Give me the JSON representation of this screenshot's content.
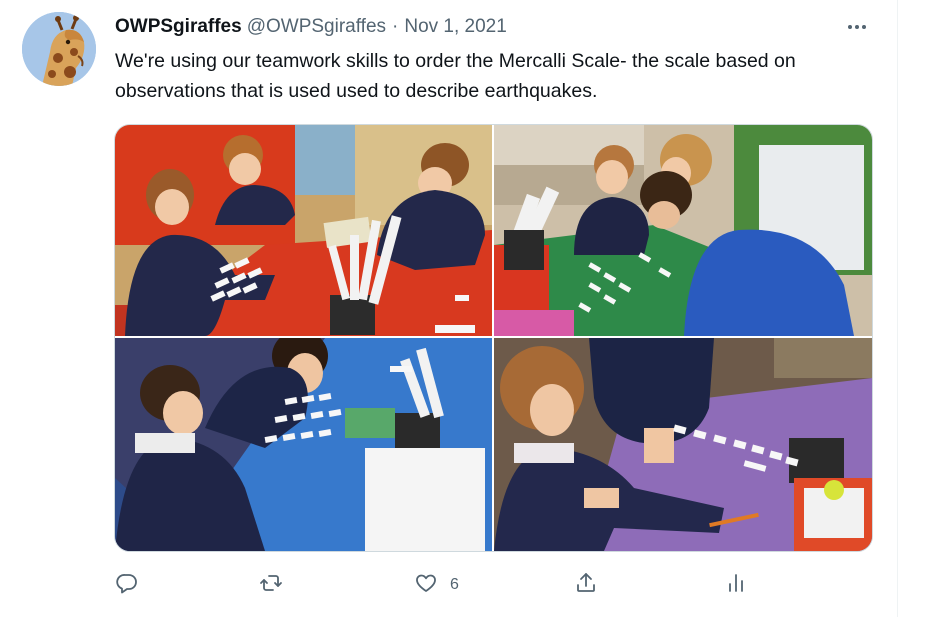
{
  "tweet": {
    "display_name": "OWPSgiraffes",
    "handle": "@OWPSgiraffes",
    "separator": "·",
    "date": "Nov 1, 2021",
    "text": "We're using our teamwork skills to order the Mercalli Scale- the scale based on observations that is used used to describe earthquakes.",
    "more_icon": "more-horizontal-icon"
  },
  "media": {
    "photos": [
      {
        "name": "photo-red-table",
        "table_color": "#d9361f"
      },
      {
        "name": "photo-green-table",
        "table_color": "#2f8a47"
      },
      {
        "name": "photo-blue-table",
        "table_color": "#2f6fc2"
      },
      {
        "name": "photo-purple-table",
        "table_color": "#8e6fb6"
      }
    ]
  },
  "actions": {
    "reply": {
      "icon": "reply-icon",
      "count": ""
    },
    "retweet": {
      "icon": "retweet-icon",
      "count": ""
    },
    "like": {
      "icon": "like-icon",
      "count": "6"
    },
    "share": {
      "icon": "share-icon",
      "count": ""
    },
    "analytics": {
      "icon": "analytics-icon",
      "count": ""
    }
  },
  "colors": {
    "text_primary": "#0f1419",
    "text_secondary": "#536471",
    "border": "#cfd9de"
  }
}
